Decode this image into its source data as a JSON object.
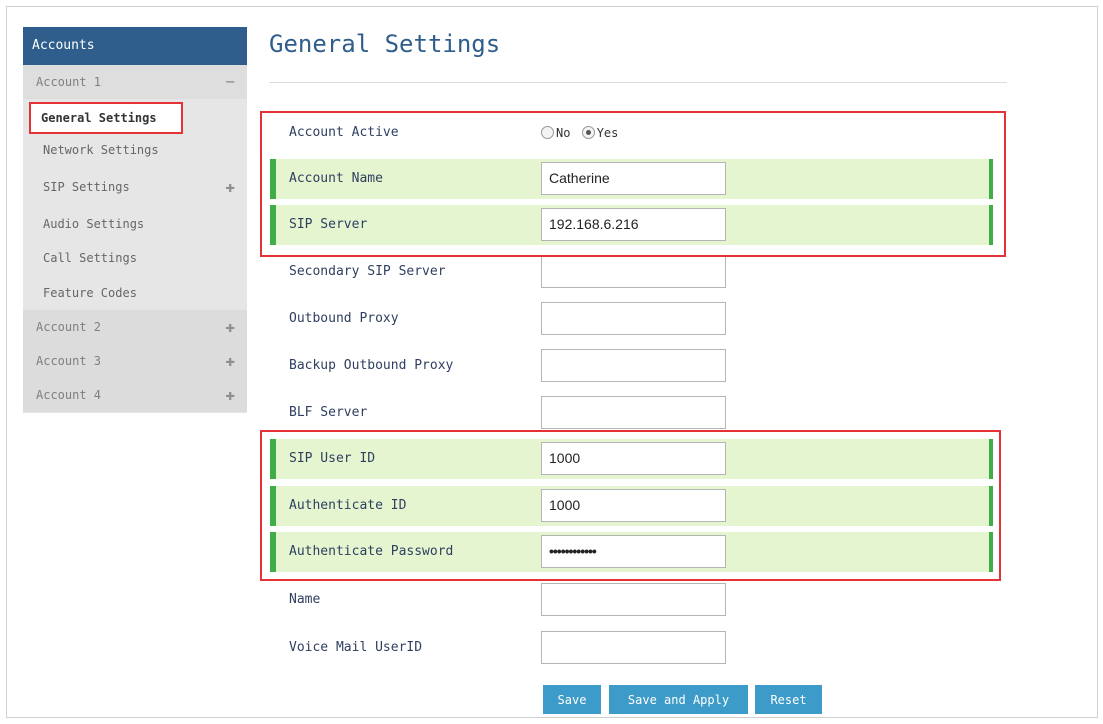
{
  "sidebar": {
    "header": "Accounts",
    "accounts": [
      {
        "label": "Account 1",
        "control": "−"
      },
      {
        "label": "Account 2",
        "control": "✚"
      },
      {
        "label": "Account 3",
        "control": "✚"
      },
      {
        "label": "Account 4",
        "control": "✚"
      }
    ],
    "sub_items": [
      {
        "label": "General Settings"
      },
      {
        "label": "Network Settings"
      },
      {
        "label": "SIP Settings",
        "control": "✚"
      },
      {
        "label": "Audio Settings"
      },
      {
        "label": "Call Settings"
      },
      {
        "label": "Feature Codes"
      }
    ]
  },
  "page_title": "General Settings",
  "form": {
    "account_active": {
      "label": "Account Active",
      "options": [
        "No",
        "Yes"
      ],
      "selected": "Yes"
    },
    "account_name": {
      "label": "Account Name",
      "value": "Catherine"
    },
    "sip_server": {
      "label": "SIP Server",
      "value": "192.168.6.216"
    },
    "secondary_sip_server": {
      "label": "Secondary SIP Server",
      "value": ""
    },
    "outbound_proxy": {
      "label": "Outbound Proxy",
      "value": ""
    },
    "backup_outbound_proxy": {
      "label": "Backup Outbound Proxy",
      "value": ""
    },
    "blf_server": {
      "label": "BLF Server",
      "value": ""
    },
    "sip_user_id": {
      "label": "SIP User ID",
      "value": "1000"
    },
    "authenticate_id": {
      "label": "Authenticate ID",
      "value": "1000"
    },
    "authenticate_password": {
      "label": "Authenticate Password",
      "value": "••••••••••••"
    },
    "name": {
      "label": "Name",
      "value": ""
    },
    "voice_mail_userid": {
      "label": "Voice Mail UserID",
      "value": ""
    }
  },
  "buttons": {
    "save": "Save",
    "save_and_apply": "Save and Apply",
    "reset": "Reset"
  },
  "colors": {
    "header_blue": "#2f5e8d",
    "highlight_green": "#e5f5d0",
    "accent_green": "#3fae49",
    "annotation_red": "#e53236",
    "button_blue": "#3d9bc9"
  }
}
